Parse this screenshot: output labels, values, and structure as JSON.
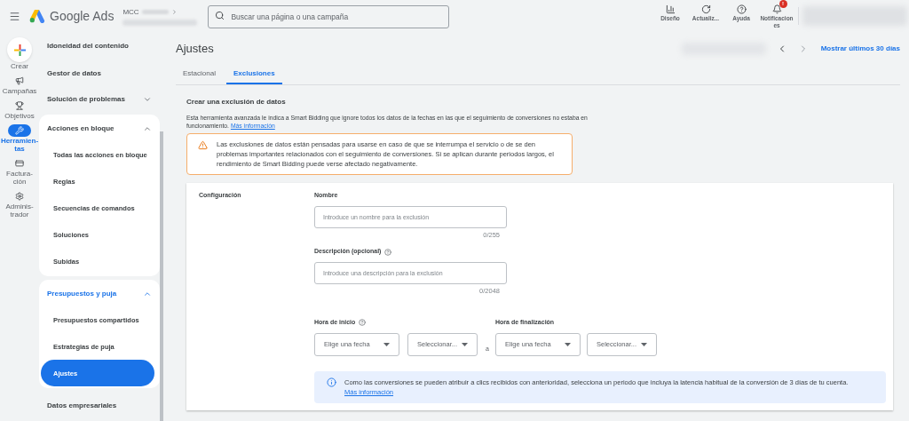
{
  "header": {
    "product": "Google Ads",
    "account_label": "MCC",
    "search": {
      "placeholder": "Buscar una página o una campaña"
    },
    "actions": [
      {
        "label": "Diseño"
      },
      {
        "label": "Actualiz..."
      },
      {
        "label": "Ayuda"
      },
      {
        "label": "Notificaciones",
        "alert": "!"
      }
    ]
  },
  "rail": [
    {
      "label": "Crear",
      "selected": false
    },
    {
      "label": "Campañas",
      "selected": false
    },
    {
      "label": "Objetivos",
      "selected": false
    },
    {
      "label": "Herramien-tas",
      "selected": true
    },
    {
      "label": "Factura-ción",
      "selected": false
    },
    {
      "label": "Adminis-trador",
      "selected": false
    }
  ],
  "sidebar": [
    {
      "kind": "link",
      "label": "Idoneidad del contenido"
    },
    {
      "kind": "link",
      "label": "Gestor de datos"
    },
    {
      "kind": "group",
      "label": "Solución de problemas",
      "expanded": false,
      "active": false
    },
    {
      "kind": "group",
      "label": "Acciones en bloque",
      "expanded": true,
      "active": false,
      "children": [
        {
          "label": "Todas las acciones en bloque",
          "selected": false
        },
        {
          "label": "Reglas",
          "selected": false
        },
        {
          "label": "Secuencias de comandos",
          "selected": false
        },
        {
          "label": "Soluciones",
          "selected": false
        },
        {
          "label": "Subidas",
          "selected": false
        }
      ]
    },
    {
      "kind": "group",
      "label": "Presupuestos y puja",
      "expanded": true,
      "active": true,
      "children": [
        {
          "label": "Presupuestos compartidos",
          "selected": false
        },
        {
          "label": "Estrategias de puja",
          "selected": false
        },
        {
          "label": "Ajustes",
          "selected": true
        }
      ]
    },
    {
      "kind": "link",
      "label": "Datos empresariales"
    }
  ],
  "page": {
    "title": "Ajustes",
    "date_link": "Mostrar últimos 30 días",
    "tabs": [
      {
        "label": "Estacional",
        "selected": false
      },
      {
        "label": "Exclusiones",
        "selected": true
      }
    ],
    "section": {
      "heading": "Crear una exclusión de datos",
      "description": "Esta herramienta avanzada le indica a Smart Bidding que ignore todos los datos de la fechas en las que el seguimiento de conversiones no estaba en funcionamiento.",
      "link": "Más información",
      "warning": "Las exclusiones de datos están pensadas para usarse en caso de que se interrumpa el servicio o de se den problemas importantes relacionados con el seguimiento de conversiones. Si se aplican durante periodos largos, el rendimiento de Smart Bidding puede verse afectado negativamente."
    },
    "form": {
      "section_label": "Configuración",
      "name": {
        "label": "Nombre",
        "placeholder": "Introduce un nombre para la exclusión",
        "counter": "0/255"
      },
      "description": {
        "label": "Descripción (opcional)",
        "placeholder": "Introduce una descripción para la exclusión",
        "counter": "0/2048"
      },
      "start": {
        "label": "Hora de inicio",
        "date": "Elige una fecha",
        "time": "Seleccionar..."
      },
      "separator": "a",
      "end": {
        "label": "Hora de finalización",
        "date": "Elige una fecha",
        "time": "Seleccionar..."
      },
      "info": {
        "text": "Como las conversiones se pueden atribuir a clics recibidos con anterioridad, selecciona un periodo que incluya la latencia habitual de la conversión de 3 días de tu cuenta.",
        "link": "Más información"
      }
    }
  }
}
